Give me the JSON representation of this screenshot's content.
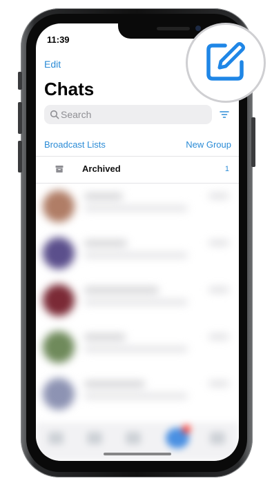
{
  "status_bar": {
    "time": "11:39"
  },
  "nav": {
    "edit_label": "Edit",
    "title": "Chats"
  },
  "search": {
    "placeholder": "Search"
  },
  "links": {
    "broadcast_lists": "Broadcast Lists",
    "new_group": "New Group"
  },
  "archived": {
    "label": "Archived",
    "count": "1"
  },
  "icons": {
    "search": "search-icon",
    "filter": "filter-icon",
    "archive": "archive-icon",
    "compose": "compose-icon"
  },
  "colors": {
    "accent": "#2a8bd6",
    "compose": "#1f86e6"
  }
}
